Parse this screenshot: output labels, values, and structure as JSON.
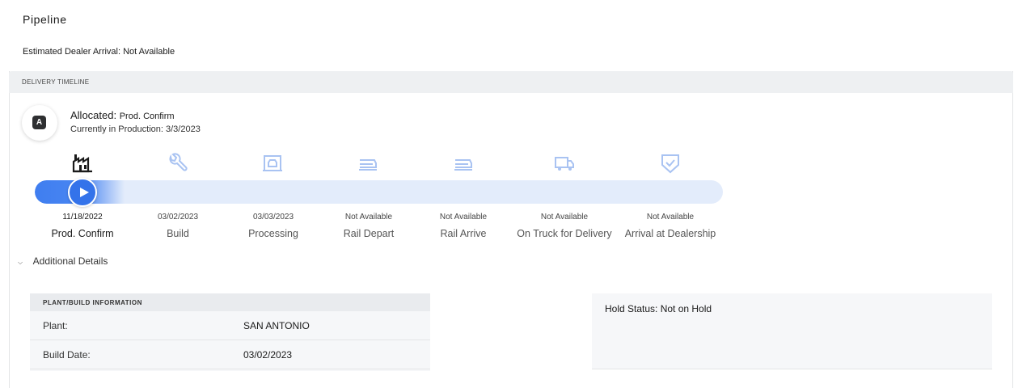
{
  "page": {
    "title": "Pipeline",
    "eta_text": "Estimated Dealer Arrival: Not Available"
  },
  "timeline": {
    "header": "DELIVERY TIMELINE",
    "status": {
      "badge": "A",
      "title_prefix": "Allocated:",
      "title_stage": "Prod. Confirm",
      "subtitle": "Currently in Production: 3/3/2023"
    },
    "progress_fraction": 0.13,
    "stages": [
      {
        "icon": "factory-icon",
        "date": "11/18/2022",
        "label": "Prod. Confirm",
        "active": true
      },
      {
        "icon": "wrench-icon",
        "date": "03/02/2023",
        "label": "Build",
        "active": false
      },
      {
        "icon": "car-processing-icon",
        "date": "03/03/2023",
        "label": "Processing",
        "active": false
      },
      {
        "icon": "rail-icon",
        "date": "Not Available",
        "label": "Rail Depart",
        "active": false
      },
      {
        "icon": "rail-icon",
        "date": "Not Available",
        "label": "Rail Arrive",
        "active": false
      },
      {
        "icon": "truck-icon",
        "date": "Not Available",
        "label": "On Truck for Delivery",
        "active": false
      },
      {
        "icon": "shield-check-icon",
        "date": "Not Available",
        "label": "Arrival at Dealership",
        "active": false
      }
    ],
    "colors": {
      "accent": "#3473ea",
      "track": "#e3ecfb",
      "icon_inactive": "#a9c3f2",
      "icon_active": "#1a1a1a"
    }
  },
  "details": {
    "toggle_label": "Additional Details",
    "plant_section": {
      "header": "PLANT/BUILD INFORMATION",
      "rows": [
        {
          "key": "Plant:",
          "value": "SAN ANTONIO"
        },
        {
          "key": "Build Date:",
          "value": "03/02/2023"
        }
      ]
    },
    "hold_status": "Hold Status: Not on Hold"
  }
}
